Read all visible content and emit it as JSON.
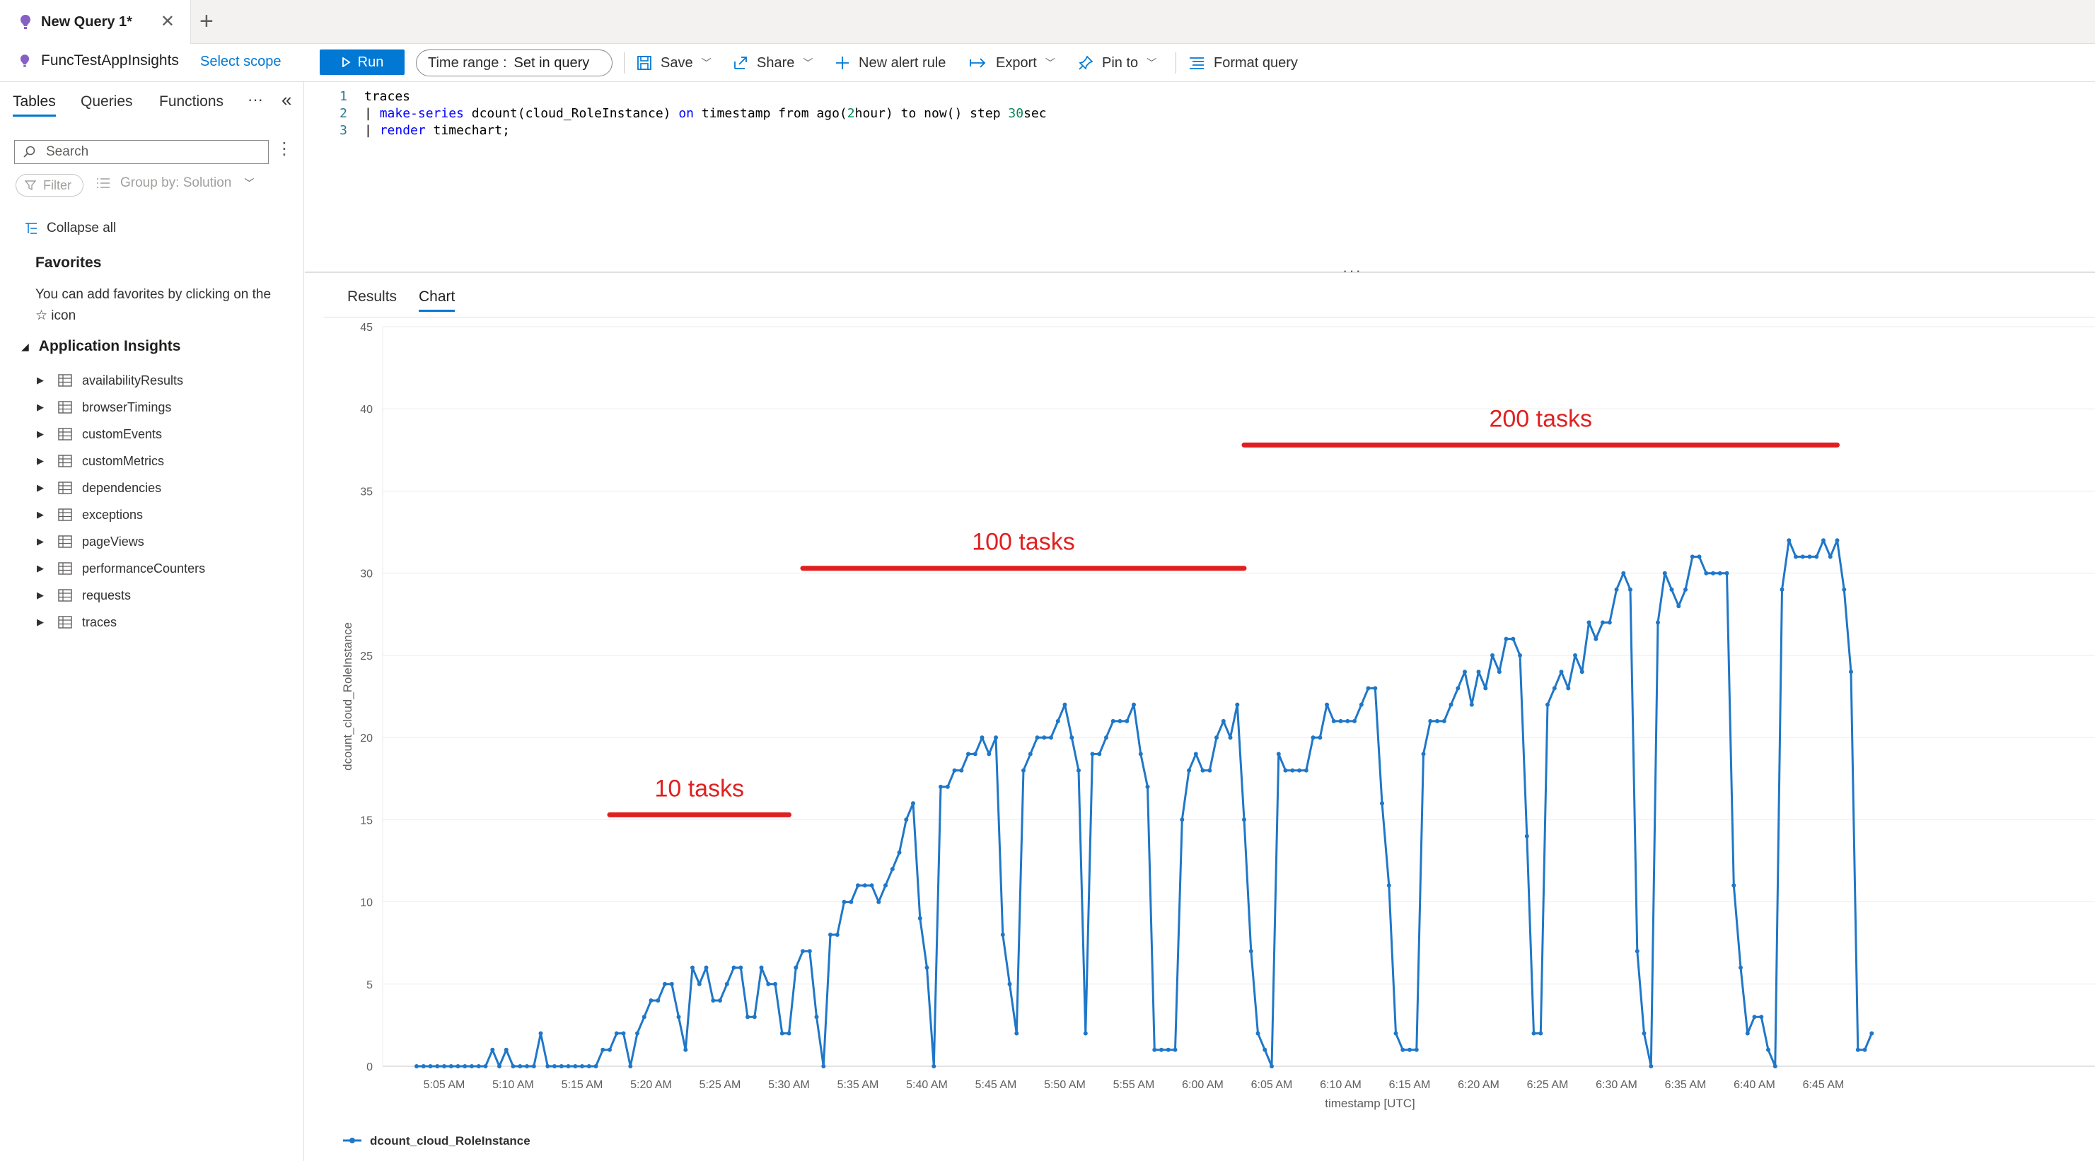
{
  "tab": {
    "title": "New Query 1*",
    "close": "✕",
    "add": "+"
  },
  "toolbar": {
    "scope_name": "FuncTestAppInsights",
    "select_scope": "Select scope",
    "run": "Run",
    "time_range_label": "Time range :",
    "time_range_value": "Set in query",
    "save": "Save",
    "share": "Share",
    "new_alert_rule": "New alert rule",
    "export": "Export",
    "pin_to": "Pin to",
    "format_query": "Format query"
  },
  "left_panel": {
    "tabs": [
      "Tables",
      "Queries",
      "Functions"
    ],
    "more": "···",
    "collapse_panel": "«",
    "search_placeholder": "Search",
    "filter": "Filter",
    "group_by": "Group by: Solution",
    "collapse_all": "Collapse all",
    "favorites_title": "Favorites",
    "favorites_text": "You can add favorites by clicking on the ☆ icon",
    "section_title": "Application Insights",
    "tables": [
      "availabilityResults",
      "browserTimings",
      "customEvents",
      "customMetrics",
      "dependencies",
      "exceptions",
      "pageViews",
      "performanceCounters",
      "requests",
      "traces"
    ]
  },
  "editor": {
    "lines": [
      {
        "num": "1",
        "text": "traces"
      },
      {
        "num": "2",
        "text": "| make-series dcount(cloud_RoleInstance) on timestamp from ago(2hour) to now() step 30sec"
      },
      {
        "num": "3",
        "text": "| render timechart;"
      }
    ],
    "splitter": "···"
  },
  "results": {
    "tabs": [
      "Results",
      "Chart"
    ],
    "active_tab": "Chart"
  },
  "colors": {
    "accent": "#0078d4",
    "series": "#1f77c8",
    "annotation": "#e02020"
  },
  "chart_data": {
    "type": "line",
    "xlabel": "timestamp [UTC]",
    "ylabel": "dcount_cloud_RoleInstance",
    "ylim": [
      0,
      45
    ],
    "yticks": [
      0,
      5,
      10,
      15,
      20,
      25,
      30,
      35,
      40,
      45
    ],
    "xtick_labels": [
      "5:05 AM",
      "5:10 AM",
      "5:15 AM",
      "5:20 AM",
      "5:25 AM",
      "5:30 AM",
      "5:35 AM",
      "5:40 AM",
      "5:45 AM",
      "5:50 AM",
      "5:55 AM",
      "6:00 AM",
      "6:05 AM",
      "6:10 AM",
      "6:15 AM",
      "6:20 AM",
      "6:25 AM",
      "6:30 AM",
      "6:35 AM",
      "6:40 AM",
      "6:45 AM"
    ],
    "x_start": "5:03 AM",
    "x_step": "30sec",
    "grid": true,
    "legend": "bottom-left",
    "series": [
      {
        "name": "dcount_cloud_RoleInstance",
        "values": [
          0,
          0,
          0,
          0,
          0,
          0,
          0,
          0,
          0,
          0,
          0,
          1,
          0,
          1,
          0,
          0,
          0,
          0,
          2,
          0,
          0,
          0,
          0,
          0,
          0,
          0,
          0,
          1,
          1,
          2,
          2,
          0,
          2,
          3,
          4,
          4,
          5,
          5,
          3,
          1,
          6,
          5,
          6,
          4,
          4,
          5,
          6,
          6,
          3,
          3,
          6,
          5,
          5,
          2,
          2,
          6,
          7,
          7,
          3,
          0,
          8,
          8,
          10,
          10,
          11,
          11,
          11,
          10,
          11,
          12,
          13,
          15,
          16,
          9,
          6,
          0,
          17,
          17,
          18,
          18,
          19,
          19,
          20,
          19,
          20,
          8,
          5,
          2,
          18,
          19,
          20,
          20,
          20,
          21,
          22,
          20,
          18,
          2,
          19,
          19,
          20,
          21,
          21,
          21,
          22,
          19,
          17,
          1,
          1,
          1,
          1,
          15,
          18,
          19,
          18,
          18,
          20,
          21,
          20,
          22,
          15,
          7,
          2,
          1,
          0,
          19,
          18,
          18,
          18,
          18,
          20,
          20,
          22,
          21,
          21,
          21,
          21,
          22,
          23,
          23,
          16,
          11,
          2,
          1,
          1,
          1,
          19,
          21,
          21,
          21,
          22,
          23,
          24,
          22,
          24,
          23,
          25,
          24,
          26,
          26,
          25,
          14,
          2,
          2,
          22,
          23,
          24,
          23,
          25,
          24,
          27,
          26,
          27,
          27,
          29,
          30,
          29,
          7,
          2,
          0,
          27,
          30,
          29,
          28,
          29,
          31,
          31,
          30,
          30,
          30,
          30,
          11,
          6,
          2,
          3,
          3,
          1,
          0,
          29,
          32,
          31,
          31,
          31,
          31,
          32,
          31,
          32,
          29,
          24,
          1,
          1,
          2
        ]
      }
    ],
    "annotations": [
      {
        "text": "10 tasks",
        "x_from": "5:17 AM",
        "x_to": "5:30 AM",
        "y": 15.3
      },
      {
        "text": "100 tasks",
        "x_from": "5:31 AM",
        "x_to": "6:03 AM",
        "y": 30.3
      },
      {
        "text": "200 tasks",
        "x_from": "6:03 AM",
        "x_to": "6:46 AM",
        "y": 37.8
      }
    ]
  }
}
